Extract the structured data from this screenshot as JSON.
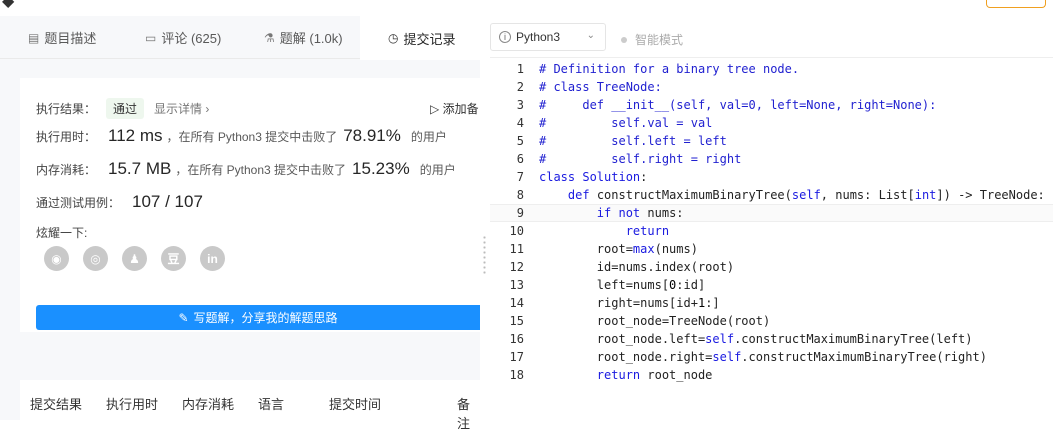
{
  "tabs": [
    {
      "label": "题目描述",
      "icon": "description-icon"
    },
    {
      "label": "评论 (625)",
      "icon": "comment-icon"
    },
    {
      "label": "题解 (1.0k)",
      "icon": "flask-icon"
    },
    {
      "label": "提交记录",
      "icon": "clock-icon"
    }
  ],
  "result": {
    "label": "执行结果：",
    "status": "通过",
    "detail_link": "显示详情 ›",
    "add_note": "添加备",
    "runtime_label": "执行用时：",
    "runtime_value": "112 ms",
    "runtime_text": "，在所有 Python3 提交中击败了",
    "runtime_pct": "78.91%",
    "runtime_suffix": "的用户",
    "memory_label": "内存消耗：",
    "memory_value": "15.7 MB",
    "memory_text": "，在所有 Python3 提交中击败了",
    "memory_pct": "15.23%",
    "memory_suffix": "的用户",
    "tests_label": "通过测试用例：",
    "tests_value": "107 / 107",
    "share_label": "炫耀一下:",
    "share_icons": [
      "wechat-icon",
      "weibo-icon",
      "qq-icon",
      "douban-icon",
      "linkedin-icon"
    ],
    "write_button": "写题解，分享我的解题思路"
  },
  "history_header": [
    "提交结果",
    "执行用时",
    "内存消耗",
    "语言",
    "提交时间",
    "备注"
  ],
  "editor": {
    "language": "Python3",
    "smart_mode": "智能模式",
    "current_line": 9,
    "lines": [
      "# Definition for a binary tree node.",
      "# class TreeNode:",
      "#     def __init__(self, val=0, left=None, right=None):",
      "#         self.val = val",
      "#         self.left = left",
      "#         self.right = right",
      "class Solution:",
      "    def constructMaximumBinaryTree(self, nums: List[int]) -> TreeNode:",
      "        if not nums:",
      "            return",
      "        root=max(nums)",
      "        id=nums.index(root)",
      "        left=nums[0:id]",
      "        right=nums[id+1:]",
      "        root_node=TreeNode(root)",
      "        root_node.left=self.constructMaximumBinaryTree(left)",
      "        root_node.right=self.constructMaximumBinaryTree(right)",
      "        return root_node"
    ]
  },
  "colors": {
    "accent": "#1a90ff",
    "pass_bg": "#eef7ee",
    "keyword": "#1a1ae0"
  }
}
